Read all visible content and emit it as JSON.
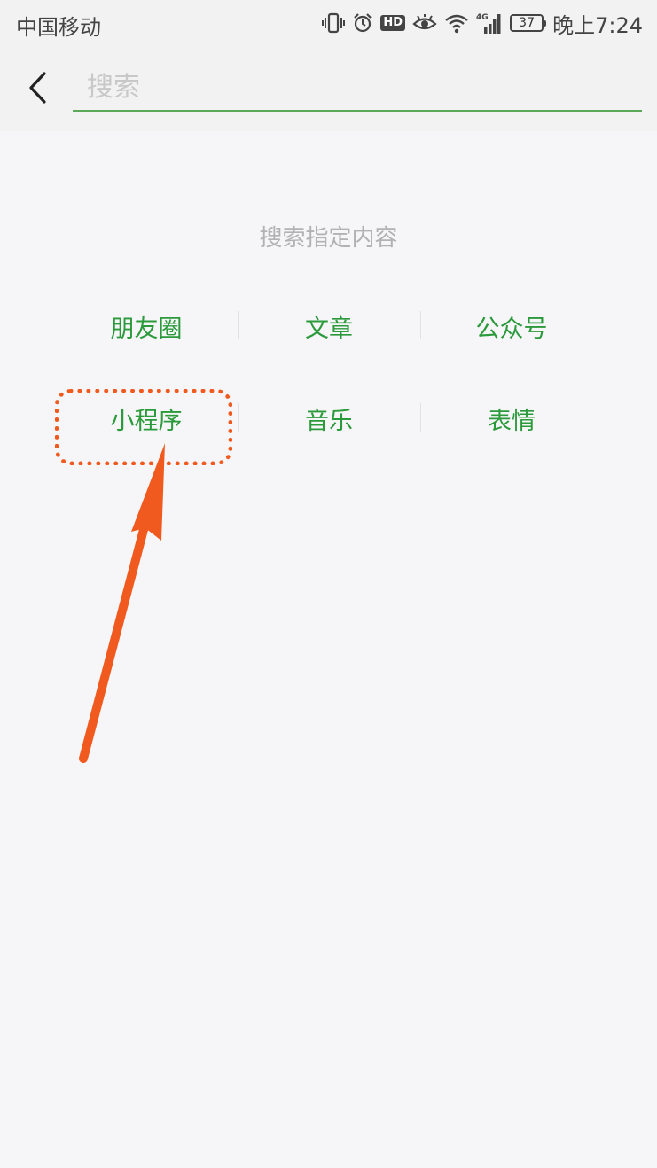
{
  "status_bar": {
    "carrier": "中国移动",
    "network": "4G",
    "battery": "37",
    "time": "晚上7:24",
    "hd": "HD",
    "icons": [
      "vibrate-icon",
      "alarm-icon",
      "hd-icon",
      "eye-icon",
      "wifi-icon",
      "signal-icon",
      "battery-icon"
    ]
  },
  "header": {
    "back_icon": "chevron-left-icon",
    "search_placeholder": "搜索"
  },
  "main": {
    "hint": "搜索指定内容",
    "categories": [
      [
        "朋友圈",
        "文章",
        "公众号"
      ],
      [
        "小程序",
        "音乐",
        "表情"
      ]
    ]
  },
  "annotation": {
    "highlight_color": "#f05a1e",
    "highlighted_item": "小程序"
  },
  "colors": {
    "accent": "#2a9a3b",
    "search_underline": "#5aa858",
    "background": "#f6f5f8",
    "hint_text": "#b2b2b2"
  }
}
